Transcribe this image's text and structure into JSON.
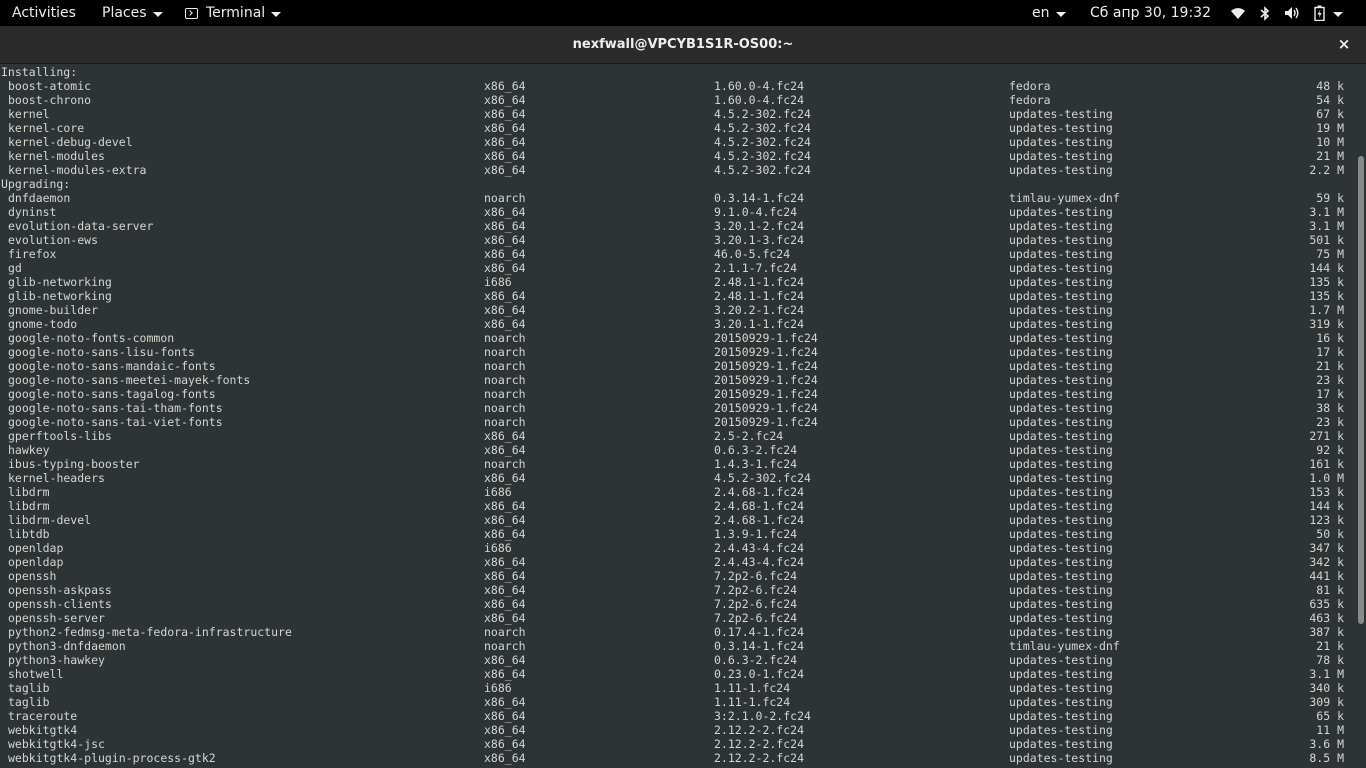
{
  "topbar": {
    "activities": "Activities",
    "places": "Places",
    "app": "Terminal",
    "language": "en",
    "clock": "Сб апр 30, 19:32",
    "status_icons": [
      "wifi-icon",
      "bluetooth-icon",
      "volume-icon",
      "battery-icon",
      "caret-down-icon"
    ]
  },
  "window": {
    "title": "nexfwall@VPCYB1S1R-OS00:~",
    "close": "×"
  },
  "installing": {
    "header": "Installing:",
    "rows": [
      {
        "name": "boost-atomic",
        "arch": "x86_64",
        "version": "1.60.0-4.fc24",
        "repo": "fedora",
        "size": "48 k"
      },
      {
        "name": "boost-chrono",
        "arch": "x86_64",
        "version": "1.60.0-4.fc24",
        "repo": "fedora",
        "size": "54 k"
      },
      {
        "name": "kernel",
        "arch": "x86_64",
        "version": "4.5.2-302.fc24",
        "repo": "updates-testing",
        "size": "67 k"
      },
      {
        "name": "kernel-core",
        "arch": "x86_64",
        "version": "4.5.2-302.fc24",
        "repo": "updates-testing",
        "size": "19 M"
      },
      {
        "name": "kernel-debug-devel",
        "arch": "x86_64",
        "version": "4.5.2-302.fc24",
        "repo": "updates-testing",
        "size": "10 M"
      },
      {
        "name": "kernel-modules",
        "arch": "x86_64",
        "version": "4.5.2-302.fc24",
        "repo": "updates-testing",
        "size": "21 M"
      },
      {
        "name": "kernel-modules-extra",
        "arch": "x86_64",
        "version": "4.5.2-302.fc24",
        "repo": "updates-testing",
        "size": "2.2 M"
      }
    ]
  },
  "upgrading": {
    "header": "Upgrading:",
    "rows": [
      {
        "name": "dnfdaemon",
        "arch": "noarch",
        "version": "0.3.14-1.fc24",
        "repo": "timlau-yumex-dnf",
        "size": "59 k"
      },
      {
        "name": "dyninst",
        "arch": "x86_64",
        "version": "9.1.0-4.fc24",
        "repo": "updates-testing",
        "size": "3.1 M"
      },
      {
        "name": "evolution-data-server",
        "arch": "x86_64",
        "version": "3.20.1-2.fc24",
        "repo": "updates-testing",
        "size": "3.1 M"
      },
      {
        "name": "evolution-ews",
        "arch": "x86_64",
        "version": "3.20.1-3.fc24",
        "repo": "updates-testing",
        "size": "501 k"
      },
      {
        "name": "firefox",
        "arch": "x86_64",
        "version": "46.0-5.fc24",
        "repo": "updates-testing",
        "size": "75 M"
      },
      {
        "name": "gd",
        "arch": "x86_64",
        "version": "2.1.1-7.fc24",
        "repo": "updates-testing",
        "size": "144 k"
      },
      {
        "name": "glib-networking",
        "arch": "i686",
        "version": "2.48.1-1.fc24",
        "repo": "updates-testing",
        "size": "135 k"
      },
      {
        "name": "glib-networking",
        "arch": "x86_64",
        "version": "2.48.1-1.fc24",
        "repo": "updates-testing",
        "size": "135 k"
      },
      {
        "name": "gnome-builder",
        "arch": "x86_64",
        "version": "3.20.2-1.fc24",
        "repo": "updates-testing",
        "size": "1.7 M"
      },
      {
        "name": "gnome-todo",
        "arch": "x86_64",
        "version": "3.20.1-1.fc24",
        "repo": "updates-testing",
        "size": "319 k"
      },
      {
        "name": "google-noto-fonts-common",
        "arch": "noarch",
        "version": "20150929-1.fc24",
        "repo": "updates-testing",
        "size": "16 k"
      },
      {
        "name": "google-noto-sans-lisu-fonts",
        "arch": "noarch",
        "version": "20150929-1.fc24",
        "repo": "updates-testing",
        "size": "17 k"
      },
      {
        "name": "google-noto-sans-mandaic-fonts",
        "arch": "noarch",
        "version": "20150929-1.fc24",
        "repo": "updates-testing",
        "size": "21 k"
      },
      {
        "name": "google-noto-sans-meetei-mayek-fonts",
        "arch": "noarch",
        "version": "20150929-1.fc24",
        "repo": "updates-testing",
        "size": "23 k"
      },
      {
        "name": "google-noto-sans-tagalog-fonts",
        "arch": "noarch",
        "version": "20150929-1.fc24",
        "repo": "updates-testing",
        "size": "17 k"
      },
      {
        "name": "google-noto-sans-tai-tham-fonts",
        "arch": "noarch",
        "version": "20150929-1.fc24",
        "repo": "updates-testing",
        "size": "38 k"
      },
      {
        "name": "google-noto-sans-tai-viet-fonts",
        "arch": "noarch",
        "version": "20150929-1.fc24",
        "repo": "updates-testing",
        "size": "23 k"
      },
      {
        "name": "gperftools-libs",
        "arch": "x86_64",
        "version": "2.5-2.fc24",
        "repo": "updates-testing",
        "size": "271 k"
      },
      {
        "name": "hawkey",
        "arch": "x86_64",
        "version": "0.6.3-2.fc24",
        "repo": "updates-testing",
        "size": "92 k"
      },
      {
        "name": "ibus-typing-booster",
        "arch": "noarch",
        "version": "1.4.3-1.fc24",
        "repo": "updates-testing",
        "size": "161 k"
      },
      {
        "name": "kernel-headers",
        "arch": "x86_64",
        "version": "4.5.2-302.fc24",
        "repo": "updates-testing",
        "size": "1.0 M"
      },
      {
        "name": "libdrm",
        "arch": "i686",
        "version": "2.4.68-1.fc24",
        "repo": "updates-testing",
        "size": "153 k"
      },
      {
        "name": "libdrm",
        "arch": "x86_64",
        "version": "2.4.68-1.fc24",
        "repo": "updates-testing",
        "size": "144 k"
      },
      {
        "name": "libdrm-devel",
        "arch": "x86_64",
        "version": "2.4.68-1.fc24",
        "repo": "updates-testing",
        "size": "123 k"
      },
      {
        "name": "libtdb",
        "arch": "x86_64",
        "version": "1.3.9-1.fc24",
        "repo": "updates-testing",
        "size": "50 k"
      },
      {
        "name": "openldap",
        "arch": "i686",
        "version": "2.4.43-4.fc24",
        "repo": "updates-testing",
        "size": "347 k"
      },
      {
        "name": "openldap",
        "arch": "x86_64",
        "version": "2.4.43-4.fc24",
        "repo": "updates-testing",
        "size": "342 k"
      },
      {
        "name": "openssh",
        "arch": "x86_64",
        "version": "7.2p2-6.fc24",
        "repo": "updates-testing",
        "size": "441 k"
      },
      {
        "name": "openssh-askpass",
        "arch": "x86_64",
        "version": "7.2p2-6.fc24",
        "repo": "updates-testing",
        "size": "81 k"
      },
      {
        "name": "openssh-clients",
        "arch": "x86_64",
        "version": "7.2p2-6.fc24",
        "repo": "updates-testing",
        "size": "635 k"
      },
      {
        "name": "openssh-server",
        "arch": "x86_64",
        "version": "7.2p2-6.fc24",
        "repo": "updates-testing",
        "size": "463 k"
      },
      {
        "name": "python2-fedmsg-meta-fedora-infrastructure",
        "arch": "noarch",
        "version": "0.17.4-1.fc24",
        "repo": "updates-testing",
        "size": "387 k"
      },
      {
        "name": "python3-dnfdaemon",
        "arch": "noarch",
        "version": "0.3.14-1.fc24",
        "repo": "timlau-yumex-dnf",
        "size": "21 k"
      },
      {
        "name": "python3-hawkey",
        "arch": "x86_64",
        "version": "0.6.3-2.fc24",
        "repo": "updates-testing",
        "size": "78 k"
      },
      {
        "name": "shotwell",
        "arch": "x86_64",
        "version": "0.23.0-1.fc24",
        "repo": "updates-testing",
        "size": "3.1 M"
      },
      {
        "name": "taglib",
        "arch": "i686",
        "version": "1.11-1.fc24",
        "repo": "updates-testing",
        "size": "340 k"
      },
      {
        "name": "taglib",
        "arch": "x86_64",
        "version": "1.11-1.fc24",
        "repo": "updates-testing",
        "size": "309 k"
      },
      {
        "name": "traceroute",
        "arch": "x86_64",
        "version": "3:2.1.0-2.fc24",
        "repo": "updates-testing",
        "size": "65 k"
      },
      {
        "name": "webkitgtk4",
        "arch": "x86_64",
        "version": "2.12.2-2.fc24",
        "repo": "updates-testing",
        "size": "11 M"
      },
      {
        "name": "webkitgtk4-jsc",
        "arch": "x86_64",
        "version": "2.12.2-2.fc24",
        "repo": "updates-testing",
        "size": "3.6 M"
      },
      {
        "name": "webkitgtk4-plugin-process-gtk2",
        "arch": "x86_64",
        "version": "2.12.2-2.fc24",
        "repo": "updates-testing",
        "size": "8.5 M"
      }
    ]
  }
}
